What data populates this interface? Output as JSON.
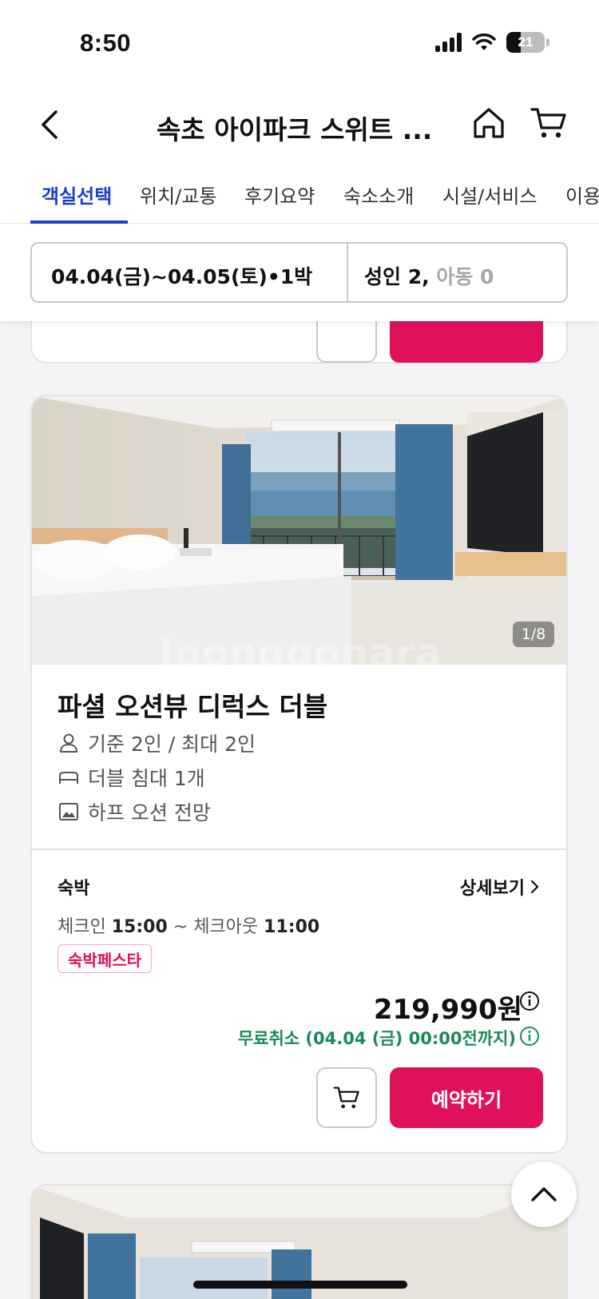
{
  "status_bar": {
    "time": "8:50",
    "battery": "21"
  },
  "header": {
    "title": "속초 아이파크 스위트 ..."
  },
  "tabs": [
    {
      "label": "객실선택",
      "active": true
    },
    {
      "label": "위치/교통",
      "active": false
    },
    {
      "label": "후기요약",
      "active": false
    },
    {
      "label": "숙소소개",
      "active": false
    },
    {
      "label": "시설/서비스",
      "active": false
    },
    {
      "label": "이용",
      "active": false
    }
  ],
  "search": {
    "dates": "04.04(금)~04.05(토)•1박",
    "adults": "성인 2,",
    "children": "아동 0"
  },
  "room": {
    "photo_count": "1/8",
    "watermark": "Joonggonara",
    "name": "파셜 오션뷰 디럭스 더블",
    "capacity": "기준 2인 / 최대 2인",
    "bed": "더블 침대 1개",
    "view": "하프 오션 전망",
    "stay_type": "숙박",
    "detail_link": "상세보기",
    "checkin_label": "체크인",
    "checkin_time": "15:00",
    "checkout_label": "~ 체크아웃",
    "checkout_time": "11:00",
    "badge": "숙박페스타",
    "price": "219,990원",
    "cancel_policy": "무료취소 (04.04 (금) 00:00전까지)",
    "book_label": "예약하기"
  },
  "colors": {
    "accent_blue": "#1a3fd1",
    "brand_pink": "#e0115b",
    "free_cancel_green": "#1a8a5a"
  }
}
